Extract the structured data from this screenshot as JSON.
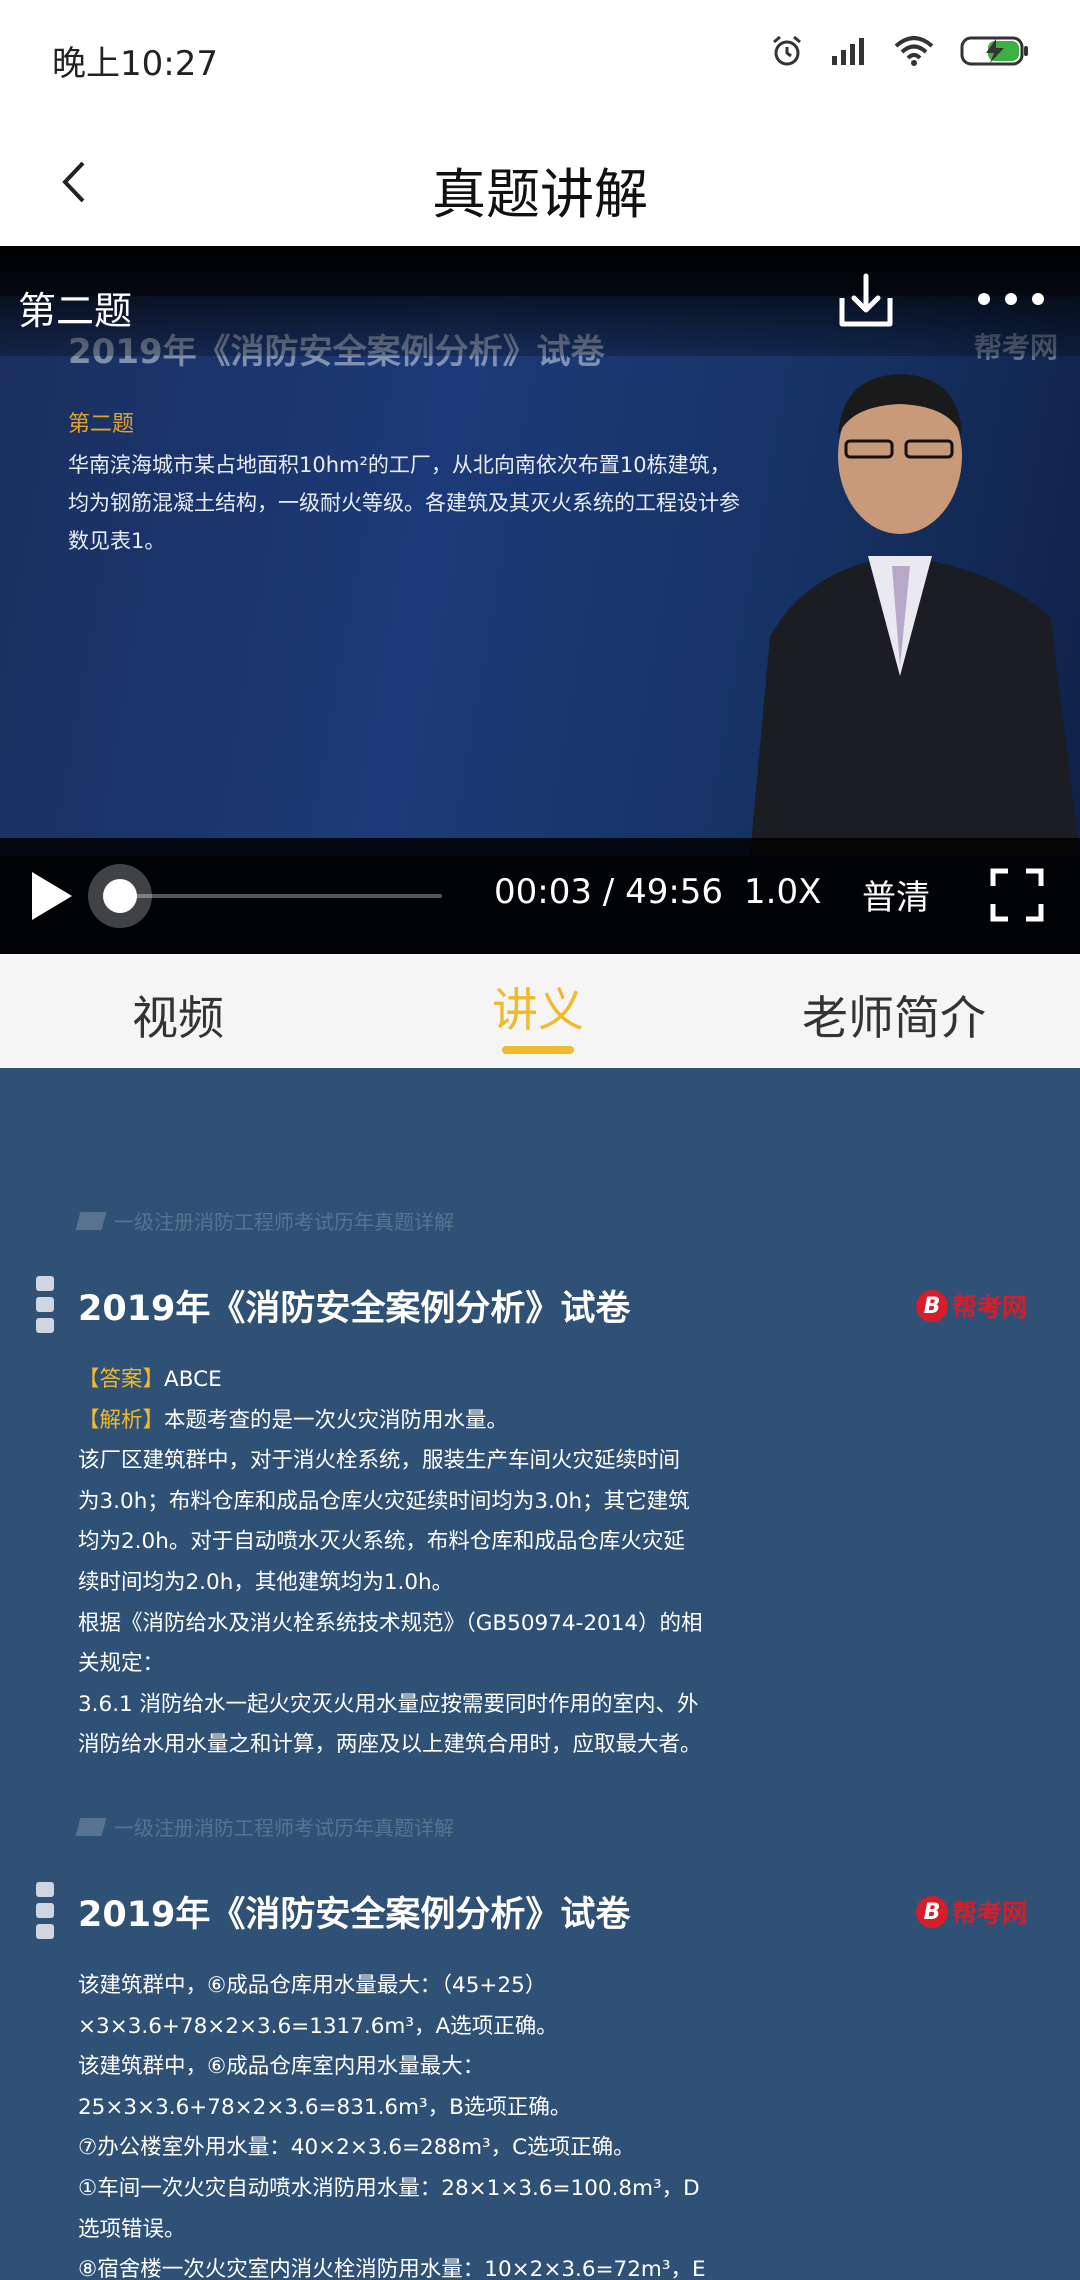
{
  "status_bar": {
    "time": "晚上10:27"
  },
  "header": {
    "title": "真题讲解"
  },
  "video": {
    "question_label": "第二题",
    "slide": {
      "title": "2019年《消防安全案例分析》试卷",
      "logo": "帮考网",
      "question": "第二题",
      "text": "华南滨海城市某占地面积10hm²的工厂，从北向南依次布置10栋建筑，均为钢筋混凝土结构，一级耐火等级。各建筑及其灭火系统的工程设计参数见表1。"
    },
    "progress_fraction": 0.0,
    "current_time": "00:03",
    "separator": "/",
    "total_time": "49:56",
    "speed": "1.0X",
    "quality": "普清"
  },
  "tabs": [
    {
      "label": "视频",
      "active": false
    },
    {
      "label": "讲义",
      "active": true
    },
    {
      "label": "老师简介",
      "active": false
    }
  ],
  "handout": {
    "watermark": "一级注册消防工程师考试历年真题详解",
    "pages": [
      {
        "title": "2019年《消防安全案例分析》试卷",
        "logo": "帮考网",
        "answer_tag": "【答案】",
        "answer": "ABCE",
        "analysis_tag": "【解析】",
        "analysis": "本题考查的是一次火灾消防用水量。",
        "lines": [
          "该厂区建筑群中，对于消火栓系统，服装生产车间火灾延续时间",
          "为3.0h；布料仓库和成品仓库火灾延续时间均为3.0h；其它建筑",
          "均为2.0h。对于自动喷水灭火系统，布料仓库和成品仓库火灾延",
          "续时间均为2.0h，其他建筑均为1.0h。",
          "根据《消防给水及消火栓系统技术规范》（GB50974-2014）的相",
          "关规定：",
          "3.6.1 消防给水一起火灾灭火用水量应按需要同时作用的室内、外",
          "消防给水用水量之和计算，两座及以上建筑合用时，应取最大者。"
        ]
      },
      {
        "title": "2019年《消防安全案例分析》试卷",
        "logo": "帮考网",
        "lines": [
          "该建筑群中，⑥成品仓库用水量最大：（45+25）",
          "×3×3.6+78×2×3.6=1317.6m³，A选项正确。",
          "该建筑群中，⑥成品仓库室内用水量最大：",
          "25×3×3.6+78×2×3.6=831.6m³，B选项正确。",
          "⑦办公楼室外用水量：40×2×3.6=288m³，C选项正确。",
          "①车间一次火灾自动喷水消防用水量：28×1×3.6=100.8m³，D",
          "选项错误。",
          "⑧宿舍楼一次火灾室内消火栓消防用水量：10×2×3.6=72m³，E"
        ]
      }
    ]
  }
}
